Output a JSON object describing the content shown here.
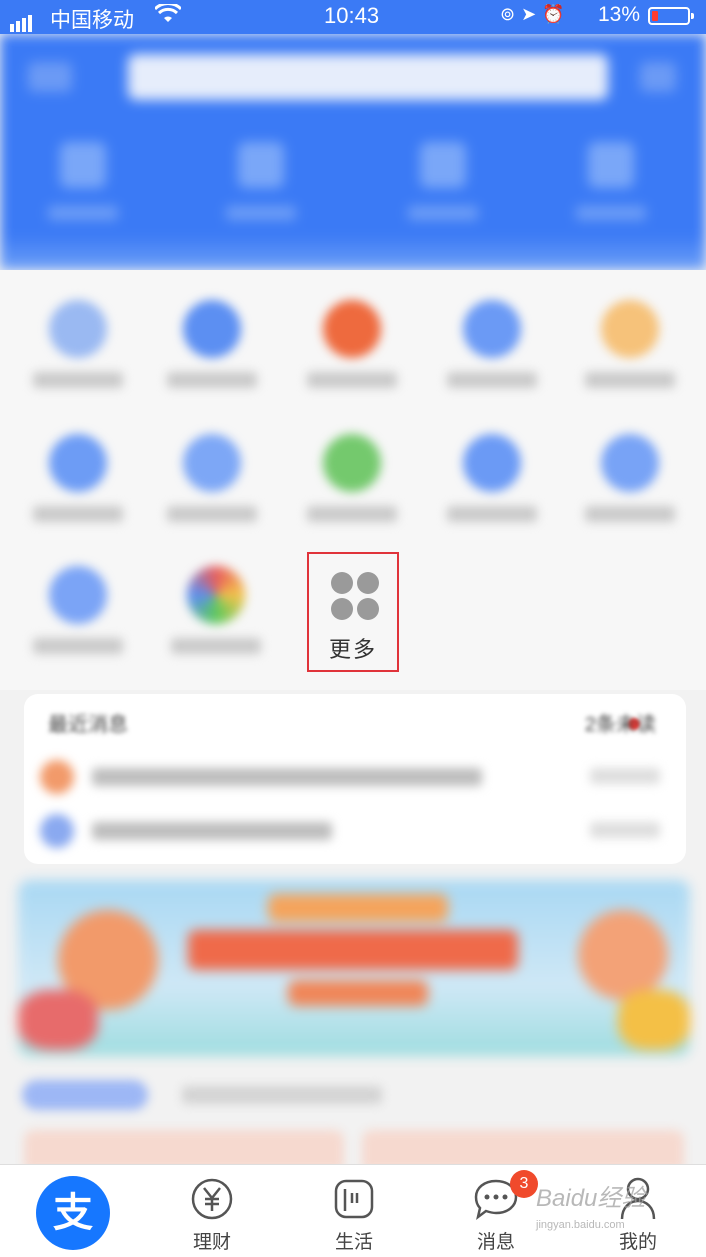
{
  "status_bar": {
    "carrier": "中国移动",
    "time": "10:43",
    "battery_percent": "13%"
  },
  "grid": {
    "more_label": "更多"
  },
  "recent_messages": {
    "title": "最近消息",
    "unread": "2条未读"
  },
  "tab_bar": {
    "home_glyph": "支",
    "tabs": [
      {
        "label": "理财",
        "icon": "yuan-icon"
      },
      {
        "label": "生活",
        "icon": "life-icon"
      },
      {
        "label": "消息",
        "icon": "chat-icon",
        "badge": "3"
      },
      {
        "label": "我的",
        "icon": "person-icon"
      }
    ]
  },
  "watermark": {
    "brand": "Baidu经验",
    "url": "jingyan.baidu.com"
  },
  "colors": {
    "header_blue": "#3b7af5",
    "highlight_border": "#e0333a",
    "badge_red": "#f04a2c",
    "home_blue": "#1677ff"
  }
}
